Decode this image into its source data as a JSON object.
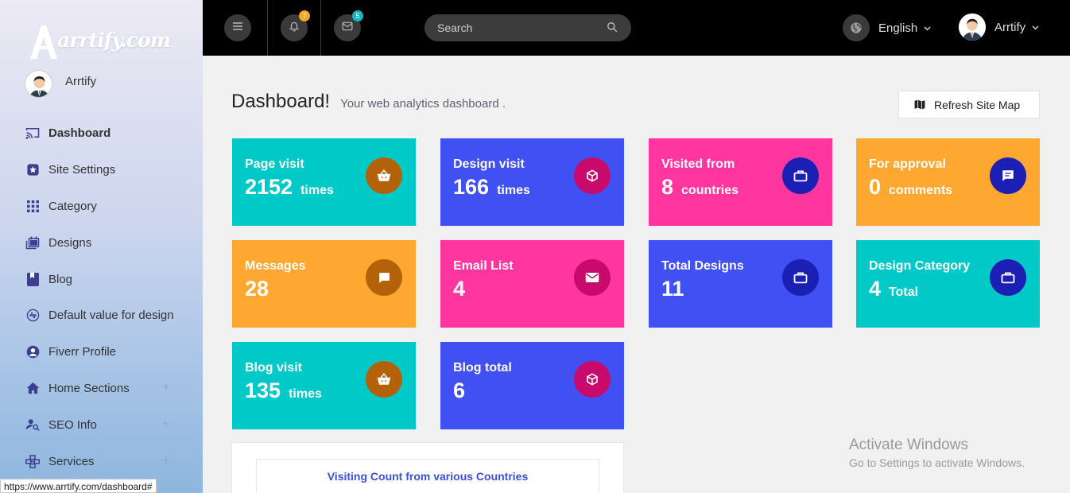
{
  "sidebar": {
    "logo_text": "arrtify.com",
    "user_name": "Arrtify",
    "items": [
      {
        "label": "Dashboard",
        "icon": "cast-icon",
        "has_plus": false,
        "active": true
      },
      {
        "label": "Site Settings",
        "icon": "settings-star-icon",
        "has_plus": false
      },
      {
        "label": "Category",
        "icon": "grid-icon",
        "has_plus": false
      },
      {
        "label": "Designs",
        "icon": "designs-icon",
        "has_plus": false
      },
      {
        "label": "Blog",
        "icon": "bookmark-icon",
        "has_plus": false
      },
      {
        "label": "Default value for design",
        "icon": "dotted-circle-icon",
        "has_plus": false
      },
      {
        "label": "Fiverr Profile",
        "icon": "user-circle-icon",
        "has_plus": false
      },
      {
        "label": "Home Sections",
        "icon": "home-icon",
        "has_plus": true
      },
      {
        "label": "SEO Info",
        "icon": "user-search-icon",
        "has_plus": true
      },
      {
        "label": "Services",
        "icon": "services-icon",
        "has_plus": true
      }
    ],
    "plus_symbol": "+"
  },
  "status_url": "https://www.arrtify.com/dashboard#",
  "topbar": {
    "notifications_count": "7",
    "messages_count": "5",
    "search_placeholder": "Search",
    "language": "English",
    "profile_name": "Arrtify"
  },
  "header": {
    "title": "Dashboard!",
    "subtitle": "Your web analytics dashboard .",
    "refresh_label": "Refresh Site Map"
  },
  "cards": [
    {
      "title": "Page visit",
      "value": "2152",
      "unit": "times",
      "bg": "#00c9c8",
      "icon_bg": "#b3620a",
      "icon": "basket-icon"
    },
    {
      "title": "Design visit",
      "value": "166",
      "unit": "times",
      "bg": "#4150f2",
      "icon_bg": "#c70a6b",
      "icon": "cube-icon"
    },
    {
      "title": "Visited from",
      "value": "8",
      "unit": "countries",
      "bg": "#ff35a0",
      "icon_bg": "#1c1fb4",
      "icon": "briefcase-icon"
    },
    {
      "title": "For approval",
      "value": "0",
      "unit": "comments",
      "bg": "#fea831",
      "icon_bg": "#1c1fb4",
      "icon": "comment-icon"
    },
    {
      "title": "Messages",
      "value": "28",
      "unit": "",
      "bg": "#fea831",
      "icon_bg": "#b3620a",
      "icon": "message-icon"
    },
    {
      "title": "Email List",
      "value": "4",
      "unit": "",
      "bg": "#ff35a0",
      "icon_bg": "#c70a6b",
      "icon": "envelope-icon"
    },
    {
      "title": "Total Designs",
      "value": "11",
      "unit": "",
      "bg": "#4150f2",
      "icon_bg": "#1c1fb4",
      "icon": "briefcase-icon"
    },
    {
      "title": "Design Category",
      "value": "4",
      "unit": "Total",
      "bg": "#00c9c8",
      "icon_bg": "#1c1fb4",
      "icon": "briefcase-icon"
    },
    {
      "title": "Blog visit",
      "value": "135",
      "unit": "times",
      "bg": "#00c9c8",
      "icon_bg": "#b3620a",
      "icon": "basket-icon"
    },
    {
      "title": "Blog total",
      "value": "6",
      "unit": "",
      "bg": "#4150f2",
      "icon_bg": "#c70a6b",
      "icon": "cube-icon"
    }
  ],
  "panel": {
    "title": "Visiting Count from various Countries"
  },
  "watermark": {
    "title": "Activate Windows",
    "subtitle": "Go to Settings to activate Windows."
  }
}
